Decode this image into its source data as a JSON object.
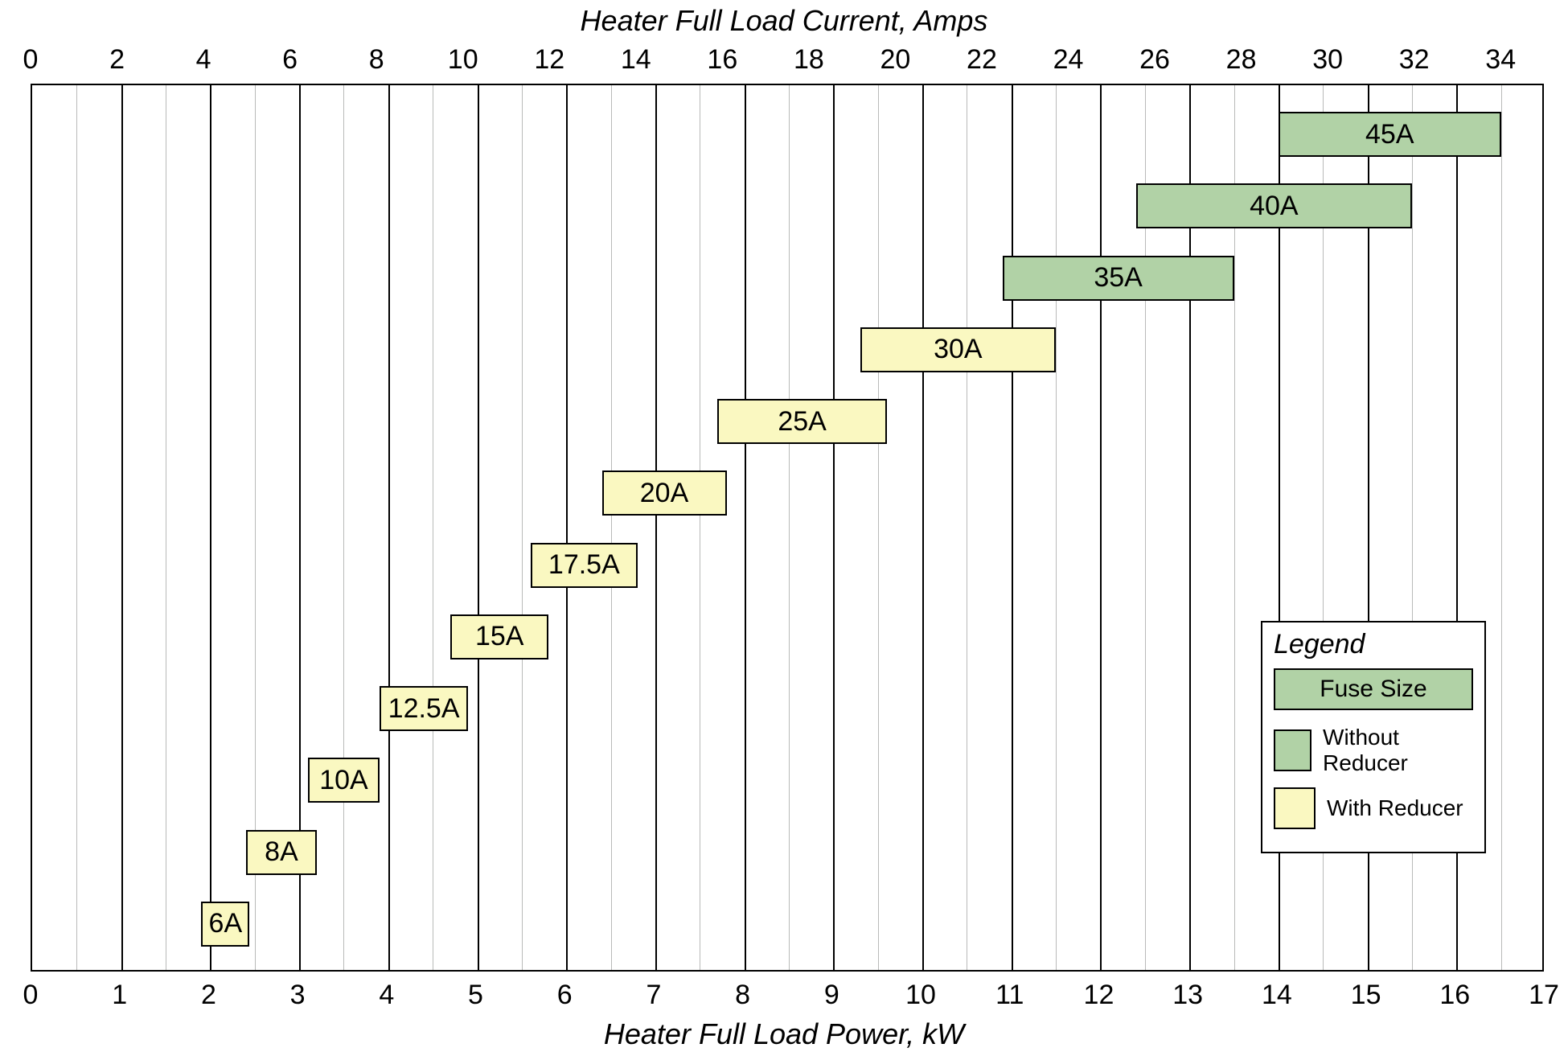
{
  "chart_data": {
    "type": "bar",
    "title_top": "Heater Full Load Current, Amps",
    "title_bottom": "Heater Full Load Power, kW",
    "axis_top": {
      "min": 0,
      "max": 35,
      "step": 2,
      "unit": "Amps"
    },
    "axis_bottom": {
      "min": 0,
      "max": 17,
      "step": 1,
      "unit": "kW"
    },
    "legend": {
      "title": "Legend",
      "fuse_label": "Fuse Size",
      "without": "Without Reducer",
      "with": "With Reducer"
    },
    "colors": {
      "without_reducer": "#b1d2a6",
      "with_reducer": "#faf8c1"
    },
    "bars": [
      {
        "label": "6A",
        "kw_from": 1.9,
        "kw_to": 2.4,
        "reducer": true
      },
      {
        "label": "8A",
        "kw_from": 2.4,
        "kw_to": 3.2,
        "reducer": true
      },
      {
        "label": "10A",
        "kw_from": 3.1,
        "kw_to": 3.9,
        "reducer": true
      },
      {
        "label": "12.5A",
        "kw_from": 3.9,
        "kw_to": 4.9,
        "reducer": true
      },
      {
        "label": "15A",
        "kw_from": 4.7,
        "kw_to": 5.8,
        "reducer": true
      },
      {
        "label": "17.5A",
        "kw_from": 5.6,
        "kw_to": 6.8,
        "reducer": true
      },
      {
        "label": "20A",
        "kw_from": 6.4,
        "kw_to": 7.8,
        "reducer": true
      },
      {
        "label": "25A",
        "kw_from": 7.7,
        "kw_to": 9.6,
        "reducer": true
      },
      {
        "label": "30A",
        "kw_from": 9.3,
        "kw_to": 11.5,
        "reducer": true
      },
      {
        "label": "35A",
        "kw_from": 10.9,
        "kw_to": 13.5,
        "reducer": false
      },
      {
        "label": "40A",
        "kw_from": 12.4,
        "kw_to": 15.5,
        "reducer": false
      },
      {
        "label": "45A",
        "kw_from": 14.0,
        "kw_to": 16.5,
        "reducer": false
      }
    ]
  }
}
